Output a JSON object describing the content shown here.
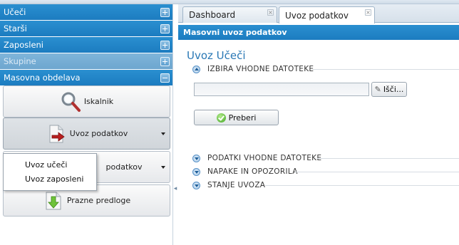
{
  "sidebar": {
    "sections": [
      {
        "label": "Učeči",
        "state": "collapsed"
      },
      {
        "label": "Starši",
        "state": "collapsed"
      },
      {
        "label": "Zaposleni",
        "state": "collapsed"
      },
      {
        "label": "Skupine",
        "state": "disabled"
      },
      {
        "label": "Masovna obdelava",
        "state": "expanded"
      }
    ],
    "tools": [
      {
        "label": "Iskalnik",
        "icon": "magnifier-icon"
      },
      {
        "label": "Uvoz podatkov",
        "icon": "import-document-icon"
      },
      {
        "label": "podatkov",
        "icon": "export-document-icon"
      },
      {
        "label": "Prazne predloge",
        "icon": "template-download-icon"
      }
    ],
    "import_menu": [
      "Uvoz učeči",
      "Uvoz zaposleni"
    ]
  },
  "tabs": [
    {
      "label": "Dashboard",
      "active": false
    },
    {
      "label": "Uvoz podatkov",
      "active": true
    }
  ],
  "panel": {
    "header": "Masovni uvoz podatkov",
    "title": "Uvoz Učeči",
    "sections": {
      "file_select": "IZBIRA VHODNE DATOTEKE",
      "file_data": "PODATKI VHODNE DATOTEKE",
      "errors": "NAPAKE IN OPOZORILA",
      "status": "STANJE UVOZA"
    },
    "file_value": "",
    "browse_label": "Išči...",
    "read_label": "Preberi"
  },
  "colors": {
    "accent": "#1c7cc0",
    "title": "#2a78b5",
    "disabled_section": "#7fb5da"
  }
}
